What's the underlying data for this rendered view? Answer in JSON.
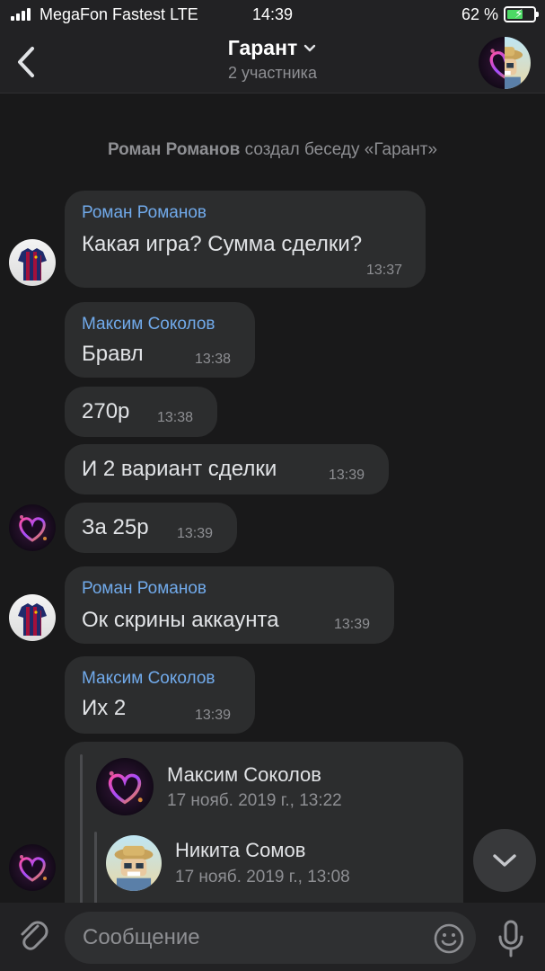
{
  "status_bar": {
    "carrier": "MegaFon Fastest LTE",
    "time": "14:39",
    "battery_percent": "62 %",
    "battery_level": 0.62
  },
  "header": {
    "title": "Гарант",
    "subtitle": "2 участника"
  },
  "service_message": {
    "author": "Роман Романов",
    "text": "создал беседу «Гарант»"
  },
  "messages": [
    {
      "author": "Роман Романов",
      "text": "Какая игра? Сумма сделки?",
      "time": "13:37"
    },
    {
      "author": "Максим Соколов",
      "text": "Бравл",
      "time": "13:38"
    },
    {
      "author": "",
      "text": "270р",
      "time": "13:38"
    },
    {
      "author": "",
      "text": "И 2 вариант сделки",
      "time": "13:39"
    },
    {
      "author": "",
      "text": "За 25р",
      "time": "13:39"
    },
    {
      "author": "Роман Романов",
      "text": "Ок скрины аккаунта",
      "time": "13:39"
    },
    {
      "author": "Максим Соколов",
      "text": "Их 2",
      "time": "13:39"
    }
  ],
  "forwarded": [
    {
      "name": "Максим Соколов",
      "date": "17 нояб. 2019 г., 13:22"
    },
    {
      "name": "Никита Сомов",
      "date": "17 нояб. 2019 г., 13:08"
    }
  ],
  "compose": {
    "placeholder": "Сообщение"
  },
  "icons": {
    "back": "chevron-left-icon",
    "title_dropdown": "chevron-down-icon",
    "scroll_down": "chevron-down-icon",
    "attach": "paperclip-icon",
    "emoji": "smiley-icon",
    "mic": "microphone-icon"
  },
  "colors": {
    "background": "#19191a",
    "bar": "#222224",
    "bubble": "#2c2d2e",
    "author_link": "#71aaeb",
    "secondary_text": "#8e8f93",
    "battery": "#4cd964"
  }
}
